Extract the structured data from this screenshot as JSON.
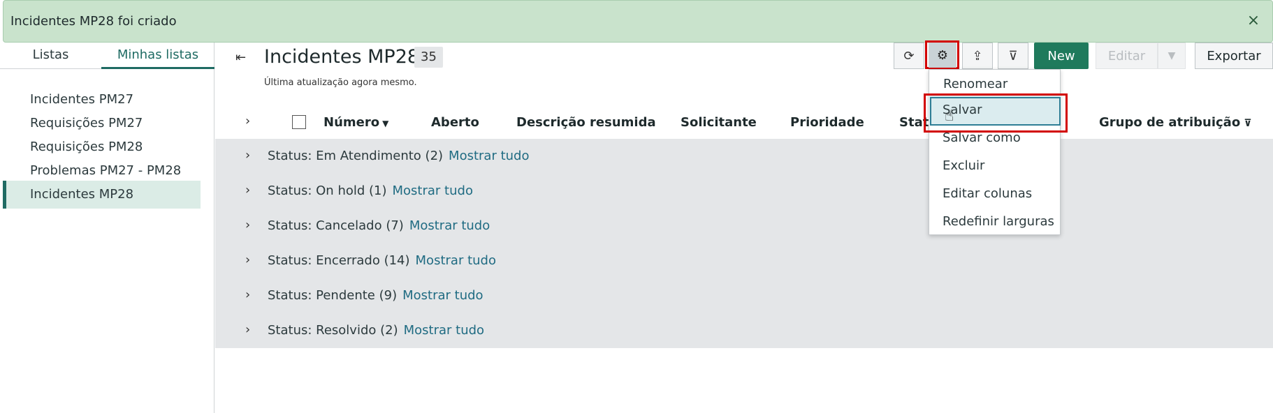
{
  "banner": {
    "message": "Incidentes MP28 foi criado",
    "close_icon": "×"
  },
  "sidebar": {
    "tabs": [
      "Listas",
      "Minhas listas"
    ],
    "active_tab": "Minhas listas",
    "items": [
      {
        "label": "Incidentes PM27"
      },
      {
        "label": "Requisições PM27"
      },
      {
        "label": "Requisições PM28"
      },
      {
        "label": "Problemas PM27 - PM28"
      },
      {
        "label": "Incidentes MP28",
        "active": true
      }
    ]
  },
  "header": {
    "title": "Incidentes MP28",
    "count": "35",
    "subtitle": "Última atualização agora mesmo."
  },
  "toolbar": {
    "refresh_icon": "⟳",
    "gear_icon": "⚙",
    "share_icon": "⇪",
    "filter_icon": "⊽",
    "new_label": "New",
    "edit_label": "Editar",
    "caret_icon": "▼",
    "export_label": "Exportar"
  },
  "table": {
    "columns": [
      "Número",
      "Aberto",
      "Descrição resumida",
      "Solicitante",
      "Prioridade",
      "Stat",
      "Grupo de atribuição"
    ],
    "sort_icon": "▼",
    "filter_icon": "⊽",
    "expand_icon": "›"
  },
  "groups": [
    {
      "label": "Status: Em Atendimento (2)",
      "link": "Mostrar tudo"
    },
    {
      "label": "Status: On hold (1)",
      "link": "Mostrar tudo"
    },
    {
      "label": "Status: Cancelado (7)",
      "link": "Mostrar tudo"
    },
    {
      "label": "Status: Encerrado (14)",
      "link": "Mostrar tudo"
    },
    {
      "label": "Status: Pendente (9)",
      "link": "Mostrar tudo"
    },
    {
      "label": "Status: Resolvido (2)",
      "link": "Mostrar tudo"
    }
  ],
  "menu": {
    "items": [
      "Renomear",
      "Salvar",
      "Salvar como",
      "Excluir",
      "Editar colunas",
      "Redefinir larguras"
    ],
    "highlighted": "Salvar"
  },
  "colors": {
    "accent": "#1f6b63",
    "new_button": "#1f7a5c",
    "link": "#1f6b82",
    "highlight_frame": "#d20000",
    "banner": "#c9e3cc"
  }
}
